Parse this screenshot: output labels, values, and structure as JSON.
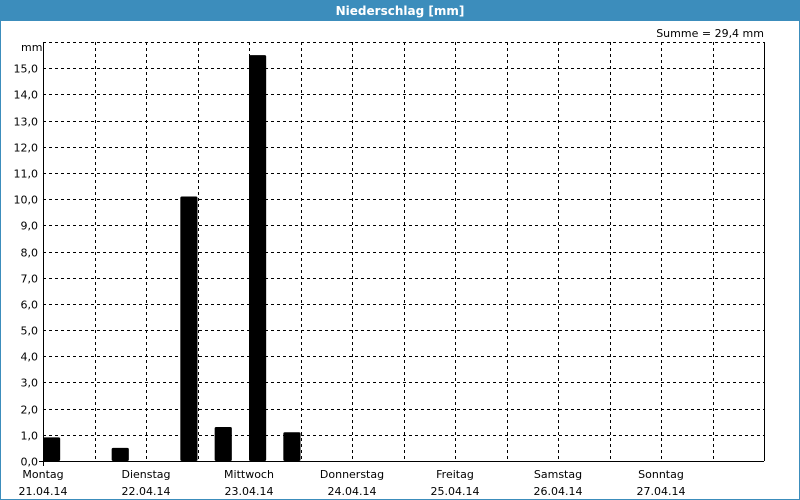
{
  "window": {
    "title": "Niederschlag [mm]"
  },
  "summary": {
    "text": "Summe = 29,4 mm"
  },
  "colors": {
    "accent": "#3c8dbc",
    "bar": "#000000",
    "grid": "#000000",
    "background": "#ffffff"
  },
  "chart_data": {
    "type": "bar",
    "title": "Niederschlag [mm]",
    "ylabel": "mm",
    "xlabel": "",
    "ylim": [
      0,
      16
    ],
    "yticks": [
      "0,0",
      "1,0",
      "2,0",
      "3,0",
      "4,0",
      "5,0",
      "6,0",
      "7,0",
      "8,0",
      "9,0",
      "10,0",
      "11,0",
      "12,0",
      "13,0",
      "14,0",
      "15,0"
    ],
    "xlim_hours": [
      0,
      168
    ],
    "bar_width_hours": 4,
    "days": [
      {
        "name": "Montag",
        "date": "21.04.14"
      },
      {
        "name": "Dienstag",
        "date": "22.04.14"
      },
      {
        "name": "Mittwoch",
        "date": "23.04.14"
      },
      {
        "name": "Donnerstag",
        "date": "24.04.14"
      },
      {
        "name": "Freitag",
        "date": "25.04.14"
      },
      {
        "name": "Samstag",
        "date": "26.04.14"
      },
      {
        "name": "Sonntag",
        "date": "27.04.14"
      }
    ],
    "bars": [
      {
        "start": "Montag 00:00",
        "value": 0.9
      },
      {
        "start": "Montag 16:00",
        "value": 0.5
      },
      {
        "start": "Dienstag 08:00",
        "value": 10.1
      },
      {
        "start": "Dienstag 16:00",
        "value": 1.3
      },
      {
        "start": "Mittwoch 00:00",
        "value": 15.5
      },
      {
        "start": "Mittwoch 08:00",
        "value": 1.1
      }
    ],
    "grid": true,
    "summary": "Summe = 29,4 mm"
  }
}
